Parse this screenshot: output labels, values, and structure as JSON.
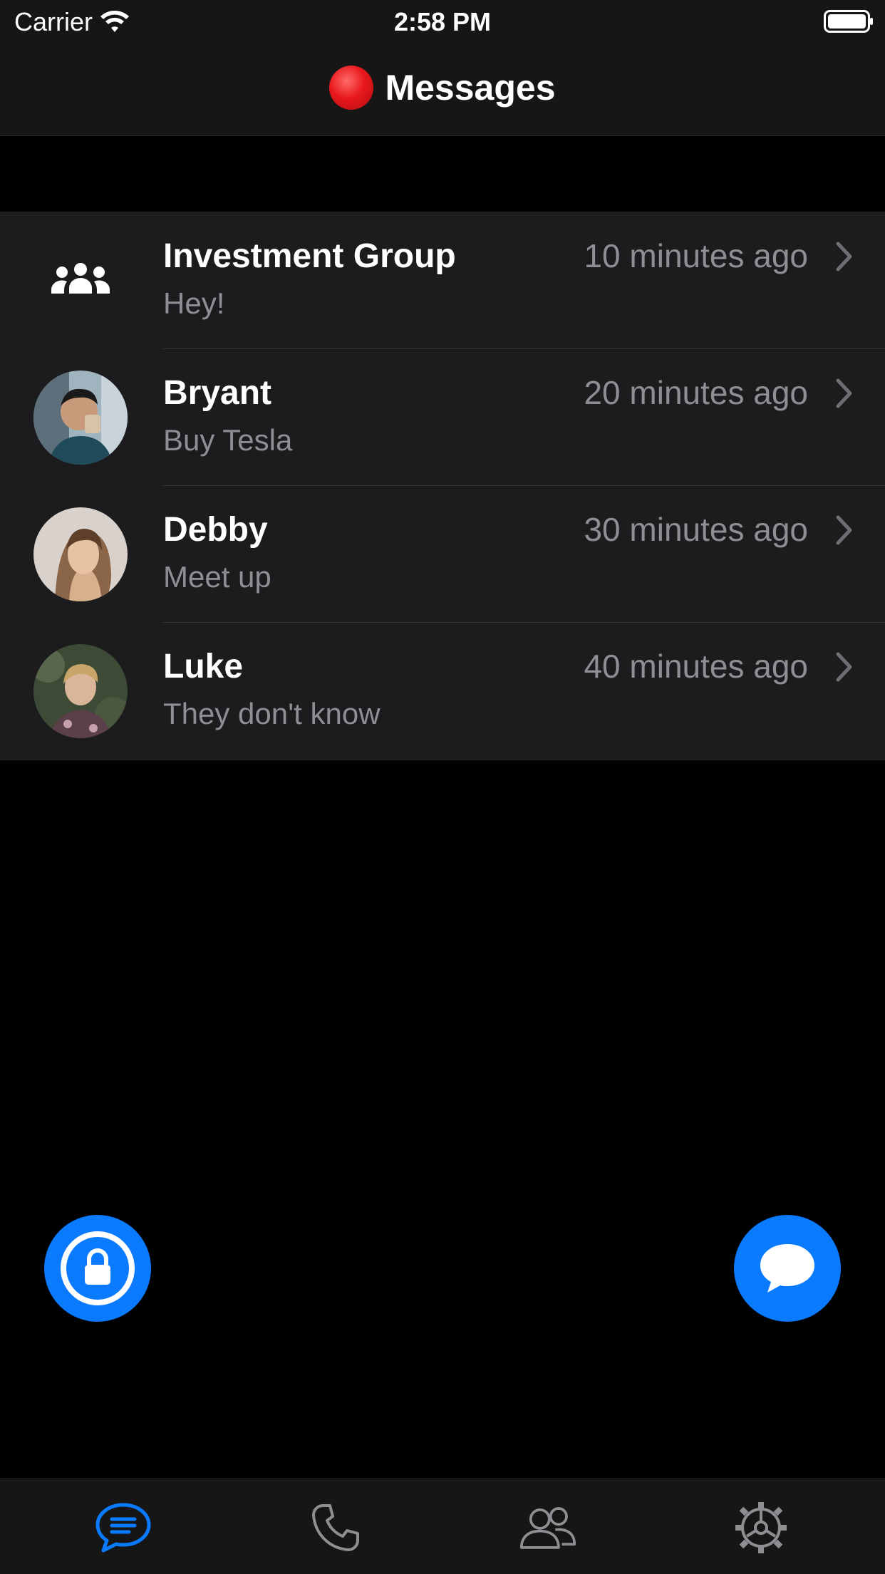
{
  "status_bar": {
    "carrier": "Carrier",
    "time": "2:58 PM"
  },
  "header": {
    "title": "Messages",
    "title_icon": "red-circle"
  },
  "conversations": [
    {
      "name": "Investment Group",
      "preview": "Hey!",
      "time": "10 minutes ago",
      "avatar": "group-icon"
    },
    {
      "name": "Bryant",
      "preview": "Buy Tesla",
      "time": "20 minutes ago",
      "avatar": "photo"
    },
    {
      "name": "Debby",
      "preview": "Meet up",
      "time": "30 minutes ago",
      "avatar": "photo"
    },
    {
      "name": "Luke",
      "preview": "They don't know",
      "time": "40 minutes ago",
      "avatar": "photo"
    }
  ],
  "fabs": {
    "left_icon": "lock-icon",
    "right_icon": "chat-bubble-icon"
  },
  "tabbar": {
    "tabs": [
      {
        "icon": "messages-icon",
        "active": true
      },
      {
        "icon": "phone-icon",
        "active": false
      },
      {
        "icon": "contacts-icon",
        "active": false
      },
      {
        "icon": "settings-icon",
        "active": false
      }
    ]
  },
  "colors": {
    "accent": "#0a7aff",
    "background": "#000000",
    "cell": "#1c1c1e",
    "secondary_text": "#8e8e93"
  }
}
